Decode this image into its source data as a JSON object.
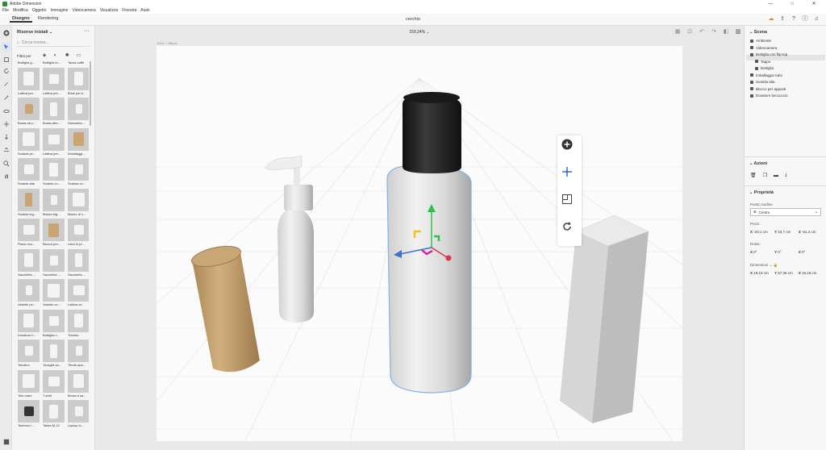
{
  "window": {
    "title": "Adobe Dimension",
    "minimize": "—",
    "maximize": "□",
    "close": "✕"
  },
  "menu": [
    "File",
    "Modifica",
    "Oggetto",
    "Immagine",
    "Videocamera",
    "Visualizza",
    "Finestra",
    "Aiuto"
  ],
  "tabs": {
    "design": "Disegno",
    "render": "Rendering"
  },
  "doc_title": "cerchio",
  "zoom": "159,24%",
  "canvas_size": "1024 × 768 px",
  "assets": {
    "title": "Risorse iniziali",
    "search_placeholder": "Cerca risorse...",
    "filter": "Filtra per",
    "items": [
      "Bottiglia g...",
      "Bottiglia to...",
      "Tazza caffè",
      "Lattina per...",
      "Lattina per...",
      "Brick per b...",
      "Busta da c...",
      "Busta alim...",
      "Sacchetto ...",
      "Scatola pe...",
      "Lattina per...",
      "Imballaggi...",
      "Scatola alta",
      "Scatola cu...",
      "Scatola co...",
      "Scatola leg...",
      "Mazzo big...",
      "Mazzo di c...",
      "Piano ricu...",
      "Blocco per...",
      "Libro in pi...",
      "Sacchetto ...",
      "Sacchetto ...",
      "Sacchetto ...",
      "Vasetto pe...",
      "Vasetto co...",
      "Lattina co...",
      "Dosatore b...",
      "Bottiglia c...",
      "Tubetto",
      "Tavolino",
      "Tovaglie su...",
      "Tenda opa...",
      "Telo mare",
      "T-shirt",
      "Borsa a sa...",
      "Telefono I...",
      "Tablet M-10",
      "Laptop fo..."
    ]
  },
  "scene": {
    "title": "Scena",
    "items": [
      {
        "label": "Ambiente",
        "indent": 0
      },
      {
        "label": "Videocamera",
        "indent": 0
      },
      {
        "label": "Bottiglia con flip-top",
        "indent": 0
      },
      {
        "label": "Tappo",
        "indent": 1
      },
      {
        "label": "Bottiglia",
        "indent": 1
      },
      {
        "label": "Imballaggio tubo",
        "indent": 0
      },
      {
        "label": "Scatola alta",
        "indent": 0
      },
      {
        "label": "Blocco per appunti",
        "indent": 0
      },
      {
        "label": "Dosatore beccuccio",
        "indent": 0
      }
    ]
  },
  "actions": {
    "title": "Azioni"
  },
  "properties": {
    "title": "Proprietà",
    "pivot_label": "Punto cardine",
    "pivot_value": "Centro",
    "pos_label": "Posiz.",
    "pos": {
      "x": "-20,1 cm",
      "y": "33,7 cm",
      "z": "-51,4 cm"
    },
    "rot_label": "Rotaz.",
    "rot": {
      "x": "0°",
      "y": "0°",
      "z": "0°"
    },
    "dim_label": "Dimensioni",
    "dim": {
      "x": "19,16 cm",
      "y": "67,36 cm",
      "z": "19,16 cm"
    }
  },
  "axis_letters": {
    "x": "X",
    "y": "Y",
    "z": "Z"
  }
}
